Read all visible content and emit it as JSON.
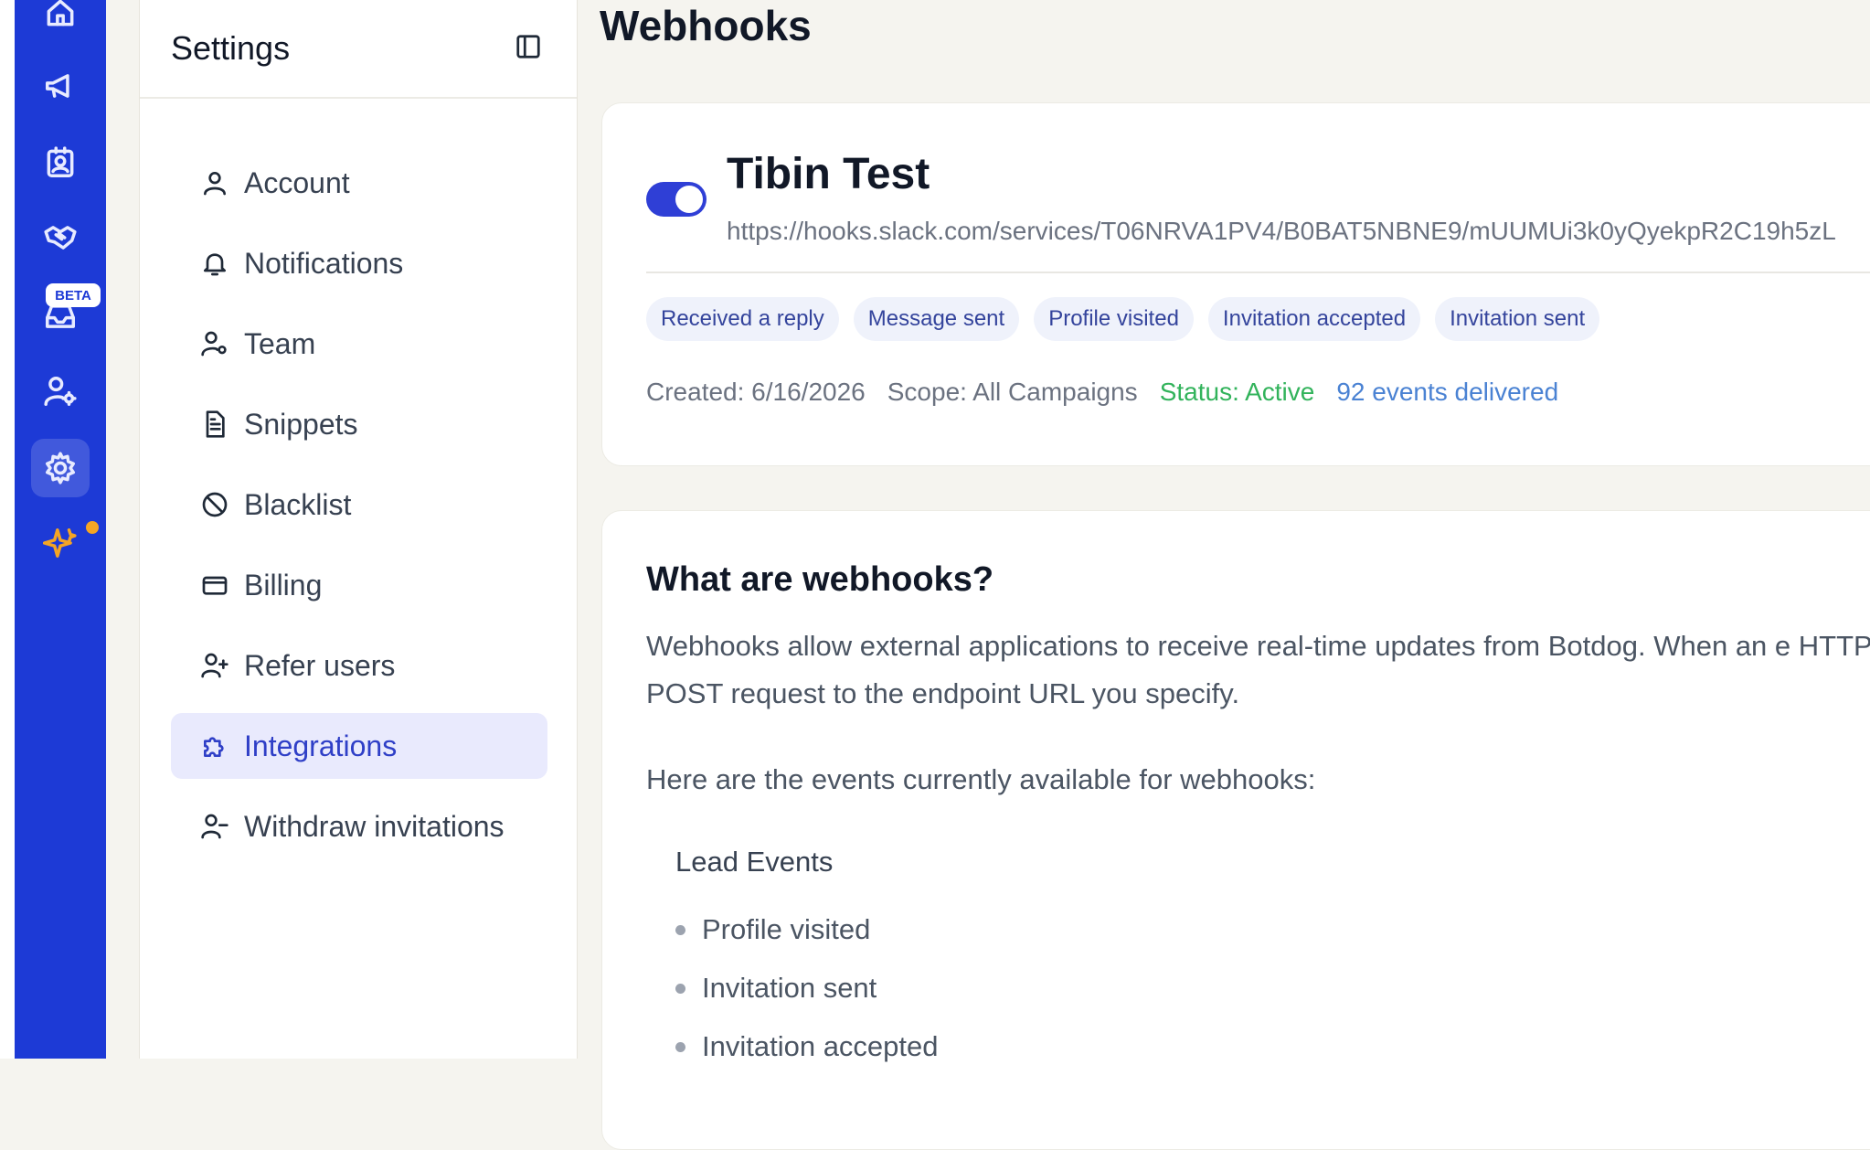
{
  "rail": {
    "icons": [
      "home-icon",
      "megaphone-icon",
      "contacts-icon",
      "handshake-icon",
      "inbox-icon",
      "user-settings-icon",
      "gear-icon",
      "sparkle-icon"
    ],
    "beta_label": "BETA",
    "colors": {
      "background": "#1d3ad6",
      "notification_dot": "#f5a524"
    }
  },
  "settings": {
    "title": "Settings",
    "items": [
      {
        "label": "Account",
        "icon": "user-icon"
      },
      {
        "label": "Notifications",
        "icon": "bell-icon"
      },
      {
        "label": "Team",
        "icon": "user-gear-icon"
      },
      {
        "label": "Snippets",
        "icon": "document-icon"
      },
      {
        "label": "Blacklist",
        "icon": "ban-icon"
      },
      {
        "label": "Billing",
        "icon": "credit-card-icon"
      },
      {
        "label": "Refer users",
        "icon": "user-plus-icon"
      },
      {
        "label": "Integrations",
        "icon": "puzzle-icon",
        "active": true
      },
      {
        "label": "Withdraw invitations",
        "icon": "user-minus-icon"
      }
    ]
  },
  "main": {
    "title": "Webhooks",
    "webhook": {
      "enabled": true,
      "name": "Tibin Test",
      "url": "https://hooks.slack.com/services/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",
      "tags": [
        "Received a reply",
        "Message sent",
        "Profile visited",
        "Invitation accepted",
        "Invitation sent"
      ],
      "created": "Created: 6/16/2026",
      "scope": "Scope: All Campaigns",
      "status": "Status: Active",
      "events_delivered": "92 events delivered"
    },
    "info": {
      "title": "What are webhooks?",
      "paragraph": "Webhooks allow external applications to receive real-time updates from Botdog. When an e HTTP POST request to the endpoint URL you specify.",
      "intro": "Here are the events currently available for webhooks:",
      "section": "Lead Events",
      "events": [
        "Profile visited",
        "Invitation sent",
        "Invitation accepted"
      ]
    }
  }
}
